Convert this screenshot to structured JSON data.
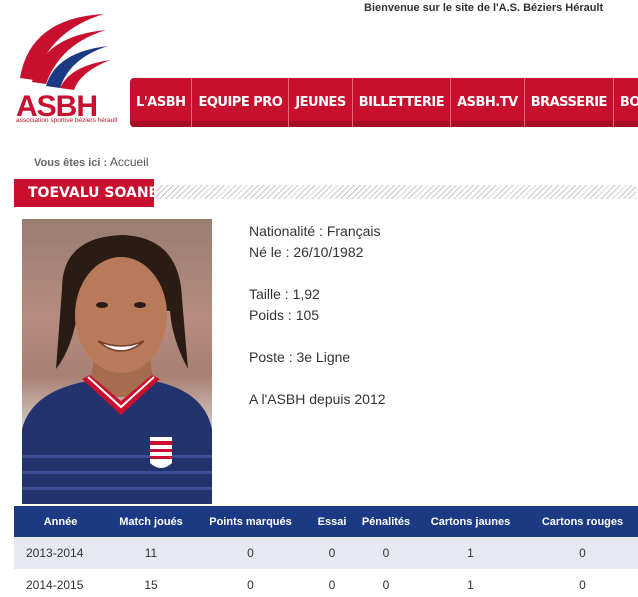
{
  "header": {
    "welcome": "Bienvenue sur le site de l'A.S. Béziers Hérault",
    "logo_text": "ASBH",
    "logo_subtitle": "association sportive béziers hérault"
  },
  "nav": {
    "items": [
      "L'ASBH",
      "EQUIPE PRO",
      "JEUNES",
      "BILLETTERIE",
      "ASBH.TV",
      "BRASSERIE",
      "BOUTIQ"
    ]
  },
  "breadcrumb": {
    "label": "Vous êtes ici :",
    "link": "Accueil"
  },
  "player": {
    "name": "TOEVALU SOANE",
    "nationality": "Nationalité : Français",
    "born": "Né le : 26/10/1982",
    "height": "Taille : 1,92",
    "weight": "Poids : 105",
    "position": "Poste : 3e Ligne",
    "since": "A l'ASBH depuis 2012"
  },
  "stats": {
    "headers": [
      "Année",
      "Match joués",
      "Points marqués",
      "Essai",
      "Pénalités",
      "Cartons jaunes",
      "Cartons rouges"
    ],
    "rows": [
      [
        "2013-2014",
        "11",
        "0",
        "0",
        "0",
        "1",
        "0"
      ],
      [
        "2014-2015",
        "15",
        "0",
        "0",
        "0",
        "1",
        "0"
      ]
    ]
  },
  "colors": {
    "brand_red": "#c8102e",
    "table_header_blue": "#1c3a84"
  }
}
